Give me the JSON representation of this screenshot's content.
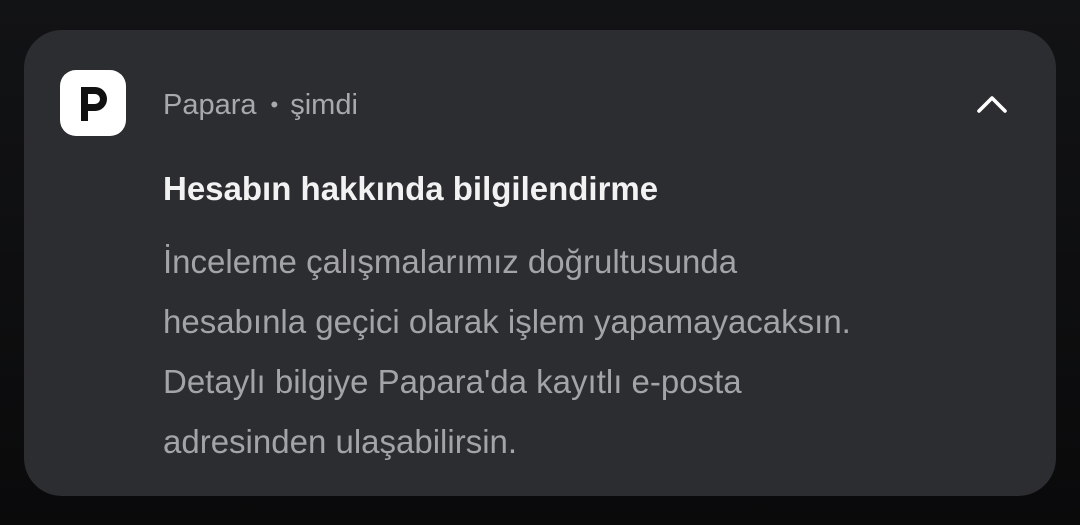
{
  "notification": {
    "app_name": "Papara",
    "separator": "•",
    "time": "şimdi",
    "icon": "papara-logo-icon",
    "expand_icon": "chevron-up-icon",
    "title": "Hesabın hakkında bilgilendirme",
    "body_lines": [
      "İnceleme çalışmalarımız doğrultusunda",
      "hesabınla geçici olarak işlem yapamayacaksın.",
      "Detaylı bilgiye Papara'da kayıtlı e-posta",
      "adresinden ulaşabilirsin."
    ]
  },
  "colors": {
    "card_background": "#2c2d30",
    "screen_background": "#0b0c0e",
    "title_text": "#f2f2f3",
    "secondary_text": "#a3a4a7",
    "icon_background": "#ffffff"
  }
}
